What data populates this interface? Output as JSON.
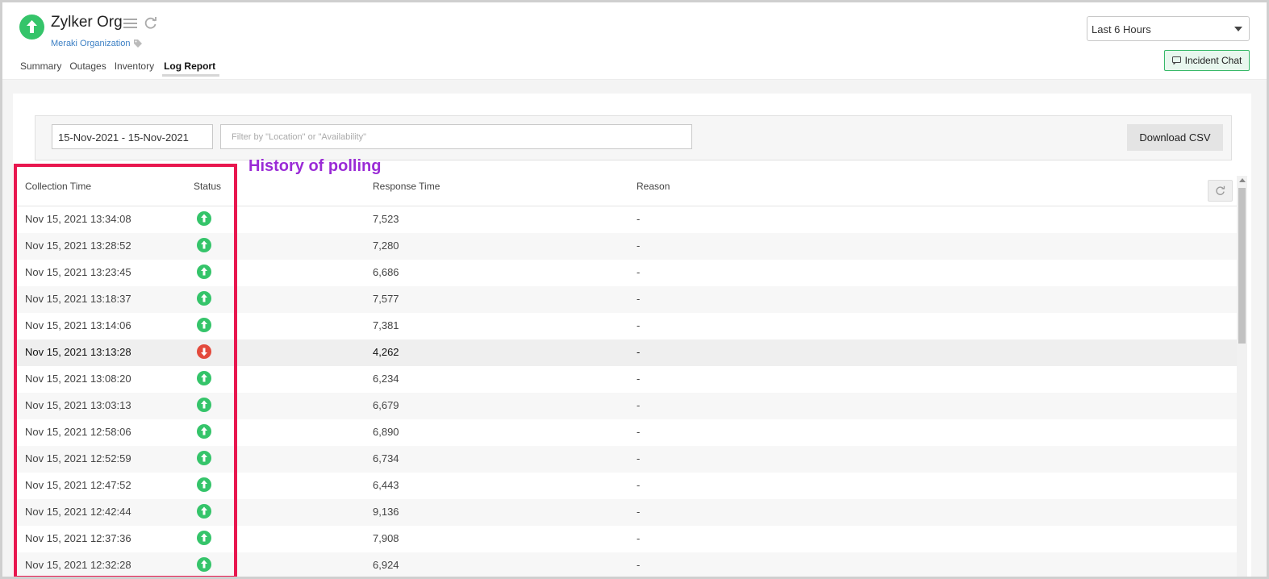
{
  "header": {
    "title": "Zylker Org",
    "subtitle": "Meraki Organization",
    "time_range": "Last 6 Hours",
    "incident_chat": "Incident Chat"
  },
  "tabs": [
    {
      "label": "Summary",
      "active": false
    },
    {
      "label": "Outages",
      "active": false
    },
    {
      "label": "Inventory",
      "active": false
    },
    {
      "label": "Log Report",
      "active": true
    }
  ],
  "filters": {
    "date_range": "15-Nov-2021 - 15-Nov-2021",
    "filter_placeholder": "Filter by \"Location\" or \"Availability\"",
    "download_label": "Download CSV"
  },
  "annotation": "History of polling",
  "colors": {
    "up": "#35c46a",
    "down": "#e34a3c",
    "highlight": "#e8174f",
    "annotation": "#9a2bd6"
  },
  "table": {
    "columns": [
      "Collection Time",
      "Status",
      "Response Time",
      "Reason"
    ],
    "rows": [
      {
        "time": "Nov 15, 2021 13:34:08",
        "status": "up",
        "response": "7,523",
        "reason": "-"
      },
      {
        "time": "Nov 15, 2021 13:28:52",
        "status": "up",
        "response": "7,280",
        "reason": "-"
      },
      {
        "time": "Nov 15, 2021 13:23:45",
        "status": "up",
        "response": "6,686",
        "reason": "-"
      },
      {
        "time": "Nov 15, 2021 13:18:37",
        "status": "up",
        "response": "7,577",
        "reason": "-"
      },
      {
        "time": "Nov 15, 2021 13:14:06",
        "status": "up",
        "response": "7,381",
        "reason": "-"
      },
      {
        "time": "Nov 15, 2021 13:13:28",
        "status": "down",
        "response": "4,262",
        "reason": "-"
      },
      {
        "time": "Nov 15, 2021 13:08:20",
        "status": "up",
        "response": "6,234",
        "reason": "-"
      },
      {
        "time": "Nov 15, 2021 13:03:13",
        "status": "up",
        "response": "6,679",
        "reason": "-"
      },
      {
        "time": "Nov 15, 2021 12:58:06",
        "status": "up",
        "response": "6,890",
        "reason": "-"
      },
      {
        "time": "Nov 15, 2021 12:52:59",
        "status": "up",
        "response": "6,734",
        "reason": "-"
      },
      {
        "time": "Nov 15, 2021 12:47:52",
        "status": "up",
        "response": "6,443",
        "reason": "-"
      },
      {
        "time": "Nov 15, 2021 12:42:44",
        "status": "up",
        "response": "9,136",
        "reason": "-"
      },
      {
        "time": "Nov 15, 2021 12:37:36",
        "status": "up",
        "response": "7,908",
        "reason": "-"
      },
      {
        "time": "Nov 15, 2021 12:32:28",
        "status": "up",
        "response": "6,924",
        "reason": "-"
      }
    ]
  }
}
